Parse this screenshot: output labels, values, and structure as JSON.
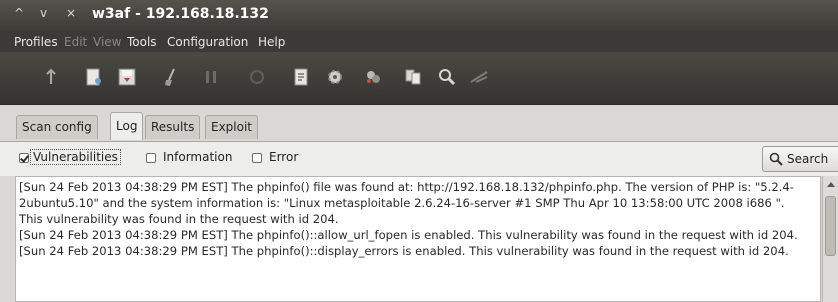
{
  "window": {
    "title": "w3af - 192.168.18.132",
    "controls": [
      "^",
      "v",
      "×"
    ]
  },
  "menubar": {
    "items": [
      "Profiles",
      "Edit",
      "View",
      "Tools",
      "Configuration",
      "Help"
    ],
    "disabled": [
      "Edit",
      "View"
    ]
  },
  "toolbar": {
    "icons": [
      "start-icon",
      "new-profile-icon",
      "save-profile-icon",
      "clear-profile-icon",
      "pause-icon",
      "stop-icon",
      "manual-request-icon",
      "settings-icon",
      "fuzzy-request-icon",
      "compare-icon",
      "search-tool-icon",
      "proxy-icon"
    ]
  },
  "tabs": [
    "Scan config",
    "Log",
    "Results",
    "Exploit"
  ],
  "active_tab": "Log",
  "filters": [
    {
      "label": "Vulnerabilities",
      "checked": true
    },
    {
      "label": "Information",
      "checked": false
    },
    {
      "label": "Error",
      "checked": false
    }
  ],
  "search_button": "Search",
  "log": {
    "text": "[Sun 24 Feb 2013 04:38:29 PM EST] The phpinfo() file was found at: http://192.168.18.132/phpinfo.php. The version of PHP is: \"5.2.4-2ubuntu5.10\" and the system information is: \"Linux metasploitable 2.6.24-16-server #1 SMP Thu Apr 10 13:58:00 UTC 2008 i686 \". This vulnerability was found in the request with id 204.\n[Sun 24 Feb 2013 04:38:29 PM EST] The phpinfo()::allow_url_fopen is enabled. This vulnerability was found in the request with id 204.\n[Sun 24 Feb 2013 04:38:29 PM EST] The phpinfo()::display_errors is enabled. This vulnerability was found in the request with id 204."
  }
}
